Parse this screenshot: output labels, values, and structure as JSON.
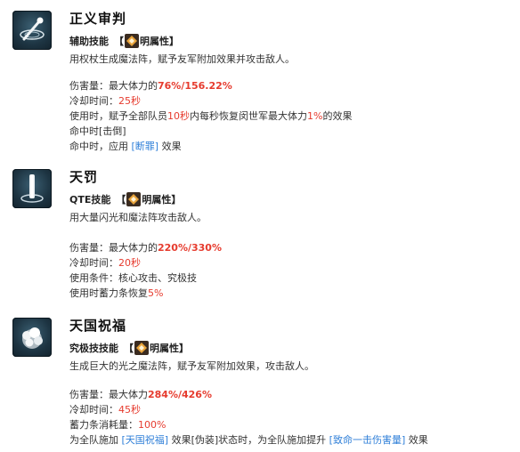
{
  "skills": [
    {
      "name": "正义审判",
      "icon": "staff-judgment-icon",
      "type": "辅助技能",
      "bracket_open": "【",
      "attribute": "明属性",
      "bracket_close": "】",
      "description": "用权杖生成魔法阵，赋予友军附加效果并攻击敌人。",
      "damage_label": "伤害量：",
      "damage_prefix": "最大体力的",
      "damage_value": "76%/156.22%",
      "cooldown_label": "冷却时间：",
      "cooldown_value": "25秒",
      "use_prefix": "使用时，赋予全部队员",
      "use_v1": "10秒",
      "use_mid": "内每秒恢复闵世军最大体力",
      "use_v2": "1%",
      "use_suffix": "的效果",
      "hit_effect": "命中时[击倒]",
      "apply_prefix": "命中时，应用 ",
      "apply_link": "[断罪]",
      "apply_suffix": " 效果"
    },
    {
      "name": "天罚",
      "icon": "light-pillar-icon",
      "type": "QTE技能",
      "bracket_open": "【",
      "attribute": "明属性",
      "bracket_close": "】",
      "description": "用大量闪光和魔法阵攻击敌人。",
      "damage_label": "伤害量：",
      "damage_prefix": "最大体力的",
      "damage_value": "220%/330%",
      "cooldown_label": "冷却时间：",
      "cooldown_value": "20秒",
      "condition": "使用条件：核心攻击、究极技",
      "gauge_prefix": "使用时蓄力条恢复",
      "gauge_value": "5%"
    },
    {
      "name": "天国祝福",
      "icon": "heaven-blessing-icon",
      "type": "究极技技能",
      "bracket_open": "【",
      "attribute": "明属性",
      "bracket_close": "】",
      "description": "生成巨大的光之魔法阵，赋予友军附加效果，攻击敌人。",
      "damage_label": "伤害量：",
      "damage_prefix": "最大体力",
      "damage_value": "284%/426%",
      "cooldown_label": "冷却时间：",
      "cooldown_value": "45秒",
      "gauge_label": "蓄力条消耗量：",
      "gauge_value": "100%",
      "team_prefix": "为全队施加 ",
      "team_link1": "[天国祝福]",
      "team_mid": " 效果[伪装]状态时，为全队施加提升 ",
      "team_link2": "[致命一击伤害量]",
      "team_suffix": " 效果"
    }
  ],
  "colors": {
    "highlight": "#e63b2e",
    "link": "#2f7fd8"
  }
}
